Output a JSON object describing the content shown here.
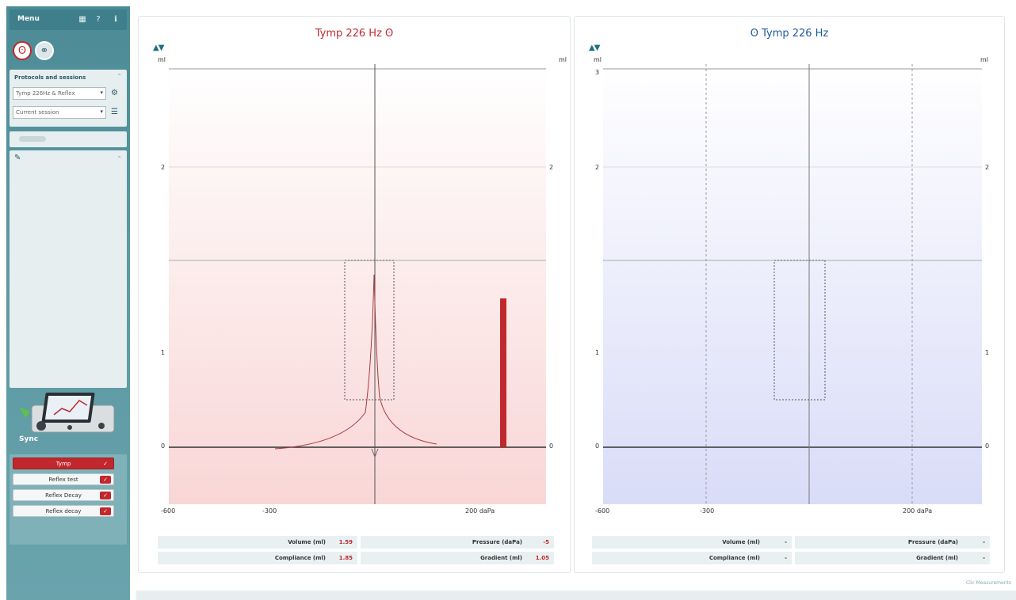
{
  "sidebar": {
    "title": "Menu",
    "header_icons": [
      "grid-icon",
      "help-icon",
      "info-icon"
    ],
    "protocol_panel_title": "Protocols and sessions",
    "protocol_select": "Tymp 226Hz & Reflex",
    "session_select": "Current session",
    "sync_label": "Sync"
  },
  "tests": [
    {
      "label": "Tymp",
      "active": true
    },
    {
      "label": "Reflex test",
      "active": false
    },
    {
      "label": "Reflex Decay",
      "active": false
    },
    {
      "label": "Reflex decay",
      "active": false
    }
  ],
  "left_chart": {
    "title": "Tymp 226 Hz",
    "ear": "right",
    "color": "#c0282d",
    "y_unit_left": "ml",
    "y_unit_right": "ml",
    "x_unit": "daPa",
    "y_ticks": [
      "2",
      "1",
      "0"
    ],
    "x_ticks": [
      "-600",
      "-300",
      "200 daPa"
    ],
    "metrics": {
      "volume_label": "Volume (ml)",
      "volume_value": "1.59",
      "pressure_label": "Pressure (daPa)",
      "pressure_value": "-5",
      "compliance_label": "Compliance (ml)",
      "compliance_value": "1.85",
      "gradient_label": "Gradient (ml)",
      "gradient_value": "1.05"
    }
  },
  "right_chart": {
    "title": "Tymp 226 Hz",
    "ear": "left",
    "color": "#1e5aa0",
    "y_unit_left": "ml",
    "y_unit_right": "ml",
    "x_unit": "daPa",
    "y_ticks": [
      "3",
      "2",
      "1",
      "0"
    ],
    "x_ticks": [
      "-600",
      "-300",
      "200 daPa"
    ],
    "metrics": {
      "volume_label": "Volume (ml)",
      "volume_value": "-",
      "pressure_label": "Pressure (daPa)",
      "pressure_value": "-",
      "compliance_label": "Compliance (ml)",
      "compliance_value": "-",
      "gradient_label": "Gradient (ml)",
      "gradient_value": "-"
    }
  },
  "footer": "Clic Measurements"
}
